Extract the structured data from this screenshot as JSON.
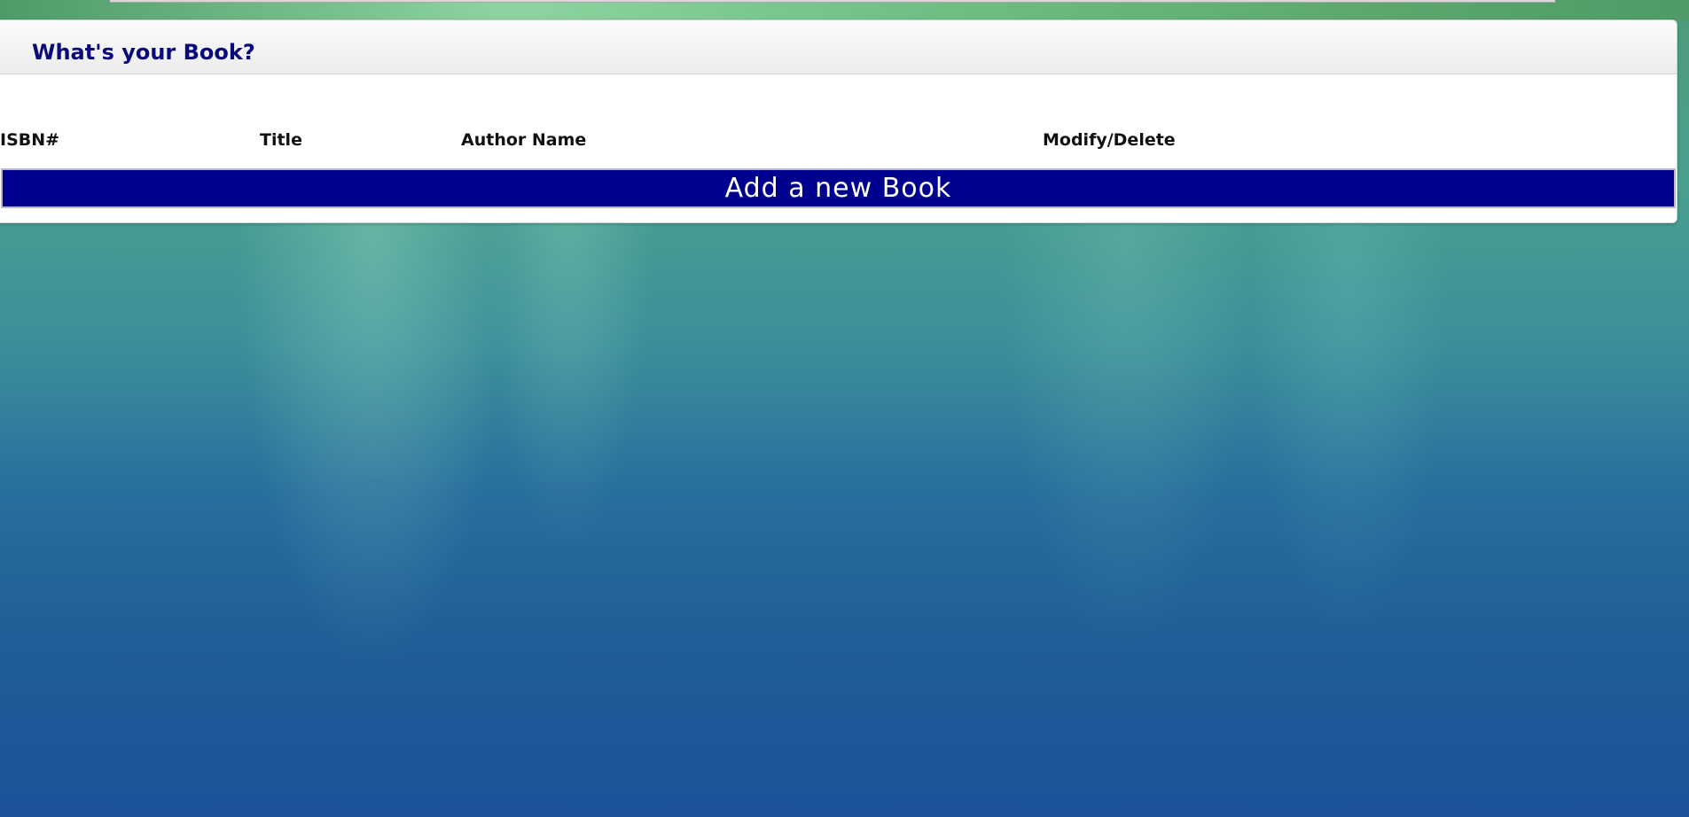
{
  "page": {
    "title": "What's your Book?"
  },
  "table": {
    "columns": [
      "ISBN#",
      "Title",
      "Author Name",
      "Modify/Delete"
    ],
    "rows": []
  },
  "actions": {
    "add_book_label": "Add a new Book"
  },
  "colors": {
    "title": "#0a0a78",
    "button_background": "#00008f",
    "button_text": "#ffffff"
  }
}
